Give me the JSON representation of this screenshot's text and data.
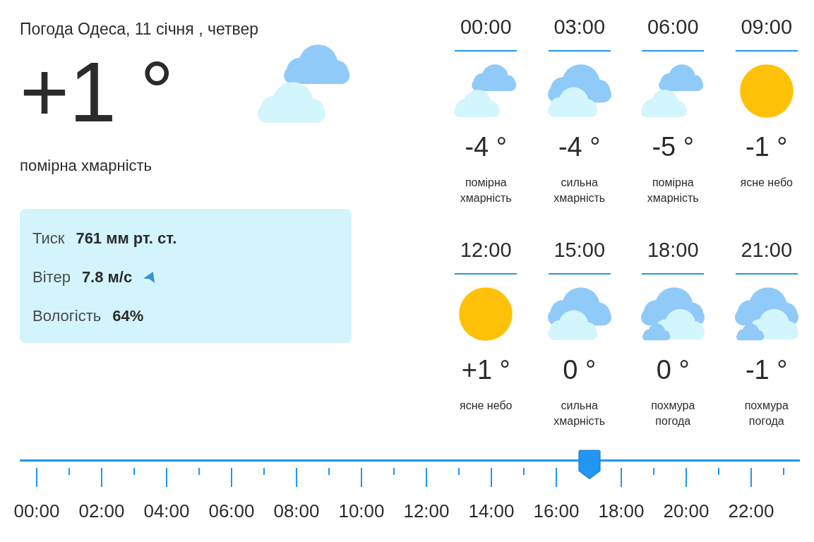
{
  "current": {
    "title": "Погода Одеса, 11 січня , четвер",
    "temperature": "+1 °",
    "kind": "partly_cloudy",
    "description": "помірна хмарність",
    "details": [
      {
        "kind": "pressure",
        "label": "Тиск",
        "value": "761 мм рт. ст."
      },
      {
        "kind": "wind",
        "label": "Вітер",
        "value": "7.8 м/с"
      },
      {
        "kind": "humidity",
        "label": "Вологість",
        "value": "64%"
      }
    ]
  },
  "forecast": [
    {
      "time": "00:00",
      "kind": "partly_cloudy",
      "temperature": "-4 °",
      "description": "помірна хмарність"
    },
    {
      "time": "03:00",
      "kind": "cloudy",
      "temperature": "-4 °",
      "description": "сильна хмарність"
    },
    {
      "time": "06:00",
      "kind": "partly_cloudy",
      "temperature": "-5 °",
      "description": "помірна хмарність"
    },
    {
      "time": "09:00",
      "kind": "clear",
      "temperature": "-1 °",
      "description": "ясне небо"
    },
    {
      "time": "12:00",
      "kind": "clear",
      "temperature": "+1 °",
      "description": "ясне небо"
    },
    {
      "time": "15:00",
      "kind": "cloudy",
      "temperature": "0 °",
      "description": "сильна хмарність"
    },
    {
      "time": "18:00",
      "kind": "overcast",
      "temperature": "0 °",
      "description": "похмура погода"
    },
    {
      "time": "21:00",
      "kind": "overcast",
      "temperature": "-1 °",
      "description": "похмура погода"
    }
  ],
  "timeline": {
    "level": 0.73,
    "labels": [
      "00:00",
      "02:00",
      "04:00",
      "06:00",
      "08:00",
      "10:00",
      "12:00",
      "14:00",
      "16:00",
      "18:00",
      "20:00",
      "22:00"
    ]
  }
}
